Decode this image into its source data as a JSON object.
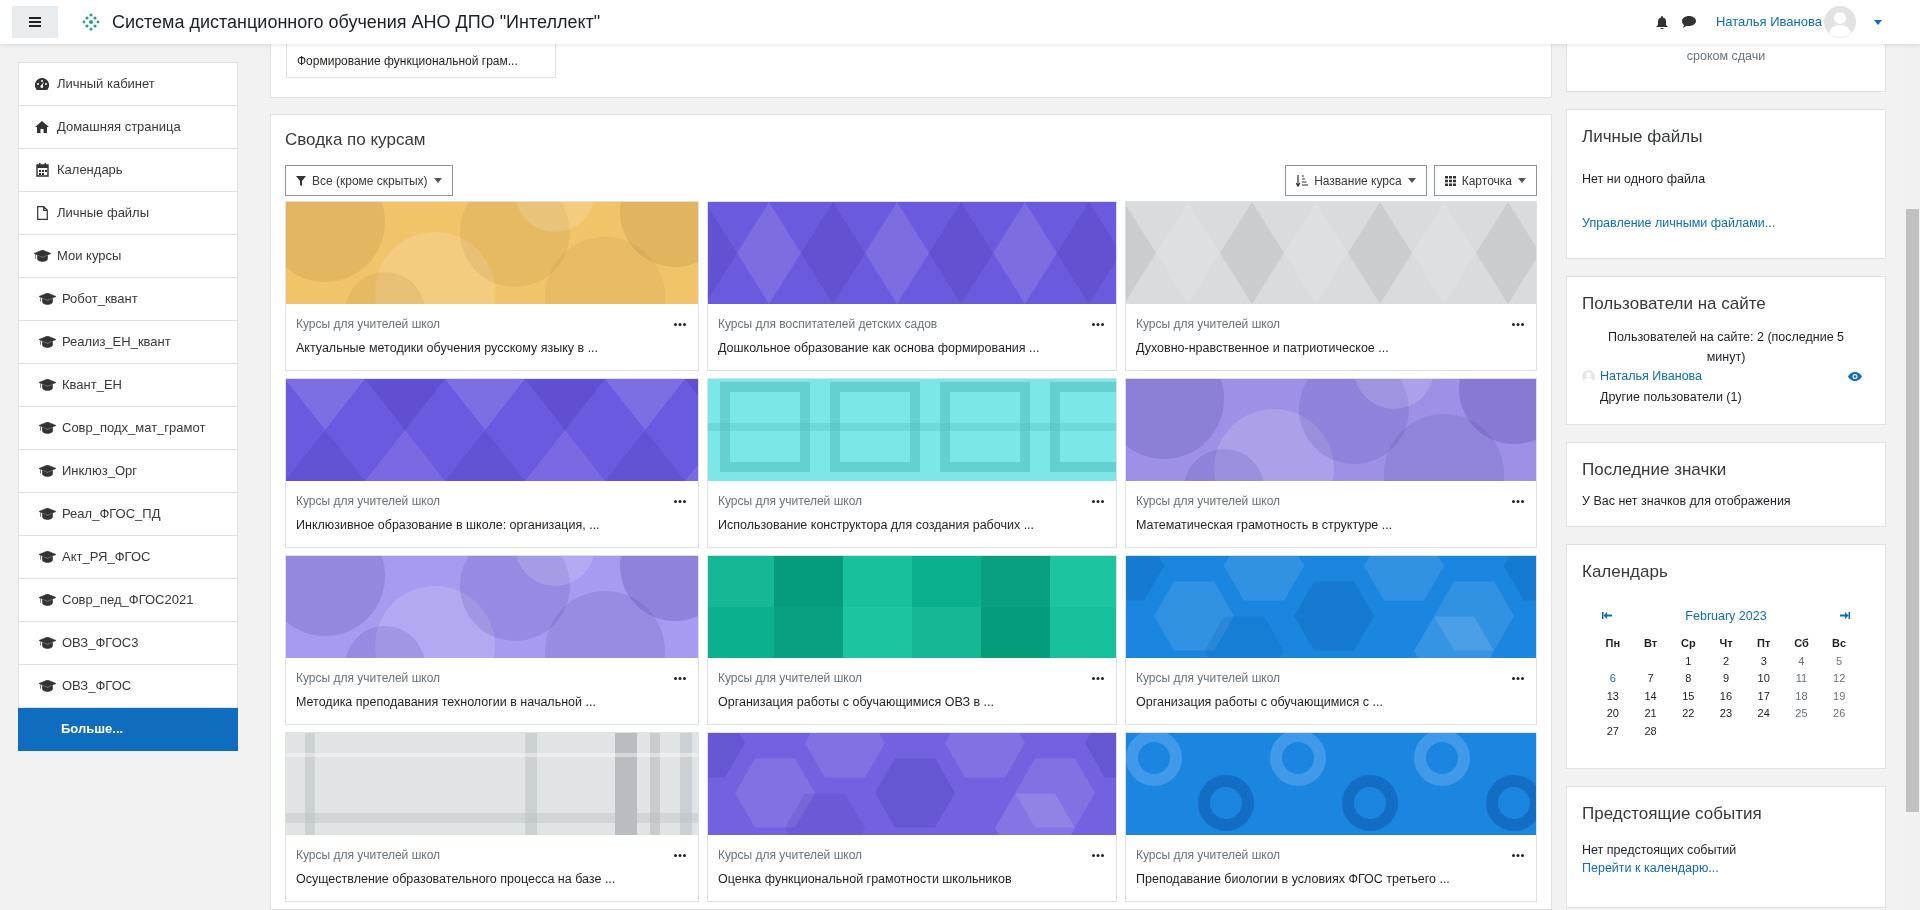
{
  "navbar": {
    "site_title": "Система дистанционного обучения АНО ДПО \"Интеллект\"",
    "user_name": "Наталья Иванова"
  },
  "sidebar": {
    "items": [
      {
        "label": "Личный кабинет",
        "kind": "dashboard",
        "selected": false
      },
      {
        "label": "Домашняя страница",
        "kind": "home",
        "selected": false
      },
      {
        "label": "Календарь",
        "kind": "calendar",
        "selected": false
      },
      {
        "label": "Личные файлы",
        "kind": "file",
        "selected": false
      },
      {
        "label": "Мои курсы",
        "kind": "course",
        "selected": false,
        "children": [
          {
            "label": "Робот_квант",
            "kind": "course",
            "selected": false
          },
          {
            "label": "Реализ_ЕН_квант",
            "kind": "course",
            "selected": false
          },
          {
            "label": "Квант_ЕН",
            "kind": "course",
            "selected": false
          },
          {
            "label": "Совр_подх_мат_грамот",
            "kind": "course",
            "selected": false
          },
          {
            "label": "Инклюз_Орг",
            "kind": "course",
            "selected": false
          },
          {
            "label": "Реал_ФГОС_ПД",
            "kind": "course",
            "selected": false
          },
          {
            "label": "Акт_РЯ_ФГОС",
            "kind": "course",
            "selected": false
          },
          {
            "label": "Совр_пед_ФГОС2021",
            "kind": "course",
            "selected": false
          },
          {
            "label": "ОВЗ_ФГОС3",
            "kind": "course",
            "selected": false
          },
          {
            "label": "ОВЗ_ФГОС",
            "kind": "course",
            "selected": false
          },
          {
            "label": "Больше...",
            "kind": "more",
            "selected": true
          }
        ]
      }
    ]
  },
  "main": {
    "top_card": {
      "course_title": "Формирование функциональной грам..."
    },
    "course_overview": {
      "title": "Сводка по курсам",
      "filter": "Все (кроме скрытых)",
      "sort": "Название курса",
      "view": "Карточка",
      "courses": [
        {
          "category": "Курсы для учителей школ",
          "name": "Актуальные методики обучения русскому языку в ..."
        },
        {
          "category": "Курсы для воспитателей детских садов",
          "name": "Дошкольное образование как основа формирования ..."
        },
        {
          "category": "Курсы для учителей школ",
          "name": "Духовно-нравственное и патриотическое ..."
        },
        {
          "category": "Курсы для учителей школ",
          "name": "Инклюзивное образование в школе: организация, ..."
        },
        {
          "category": "Курсы для учителей школ",
          "name": "Использование конструктора для создания рабочих ..."
        },
        {
          "category": "Курсы для учителей школ",
          "name": "Математическая грамотность в структуре ..."
        },
        {
          "category": "Курсы для учителей школ",
          "name": "Методика преподавания технологии в начальной ..."
        },
        {
          "category": "Курсы для учителей школ",
          "name": "Организация работы с обучающимися ОВЗ в ..."
        },
        {
          "category": "Курсы для учителей школ",
          "name": "Организация работы с обучающимися с ..."
        },
        {
          "category": "Курсы для учителей школ",
          "name": "Осуществление образовательного процесса на базе ..."
        },
        {
          "category": "Курсы для учителей школ",
          "name": "Оценка функциональной грамотности школьников"
        },
        {
          "category": "Курсы для учителей школ",
          "name": "Преподавание биологии в условиях ФГОС третьего ..."
        }
      ]
    }
  },
  "blocks": {
    "timeline": {
      "text": "сроком сдачи"
    },
    "private_files": {
      "title": "Личные файлы",
      "text": "Нет ни одного файла",
      "link": "Управление личными файлами..."
    },
    "online_users": {
      "title": "Пользователи на сайте",
      "summary": "Пользователей на сайте: 2 (последние 5 минут)",
      "users": [
        {
          "name": "Наталья Иванова"
        }
      ],
      "others": "Другие пользователи (1)"
    },
    "badges": {
      "title": "Последние значки",
      "text": "У Вас нет значков для отображения"
    },
    "calendar": {
      "title": "Календарь",
      "month": "February 2023",
      "weekdays": [
        "Пн",
        "Вт",
        "Ср",
        "Чт",
        "Пт",
        "Сб",
        "Вс"
      ],
      "weeks": [
        [
          {
            "day": "1",
            "kind": "weekday"
          },
          {
            "day": "2",
            "kind": "weekday"
          },
          {
            "day": "3",
            "kind": "weekday"
          },
          {
            "day": "4",
            "kind": "weekend"
          },
          {
            "day": "5",
            "kind": "weekend"
          }
        ],
        [
          {
            "day": "6",
            "kind": "event"
          },
          {
            "day": "7",
            "kind": "weekday"
          },
          {
            "day": "8",
            "kind": "weekday"
          },
          {
            "day": "9",
            "kind": "weekday"
          },
          {
            "day": "10",
            "kind": "weekday"
          },
          {
            "day": "11",
            "kind": "weekend"
          },
          {
            "day": "12",
            "kind": "weekend"
          }
        ],
        [
          {
            "day": "13",
            "kind": "weekday"
          },
          {
            "day": "14",
            "kind": "weekday"
          },
          {
            "day": "15",
            "kind": "weekday"
          },
          {
            "day": "16",
            "kind": "weekday"
          },
          {
            "day": "17",
            "kind": "weekday"
          },
          {
            "day": "18",
            "kind": "weekend"
          },
          {
            "day": "19",
            "kind": "weekend"
          }
        ],
        [
          {
            "day": "20",
            "kind": "weekday"
          },
          {
            "day": "21",
            "kind": "weekday"
          },
          {
            "day": "22",
            "kind": "weekday"
          },
          {
            "day": "23",
            "kind": "weekday"
          },
          {
            "day": "24",
            "kind": "weekday"
          },
          {
            "day": "25",
            "kind": "weekend"
          },
          {
            "day": "26",
            "kind": "weekend"
          }
        ],
        [
          {
            "day": "27",
            "kind": "weekday"
          },
          {
            "day": "28",
            "kind": "weekday"
          }
        ]
      ]
    },
    "upcoming_events": {
      "title": "Предстоящие события",
      "text": "Нет предстоящих событий",
      "link": "Перейти к календарю..."
    }
  }
}
